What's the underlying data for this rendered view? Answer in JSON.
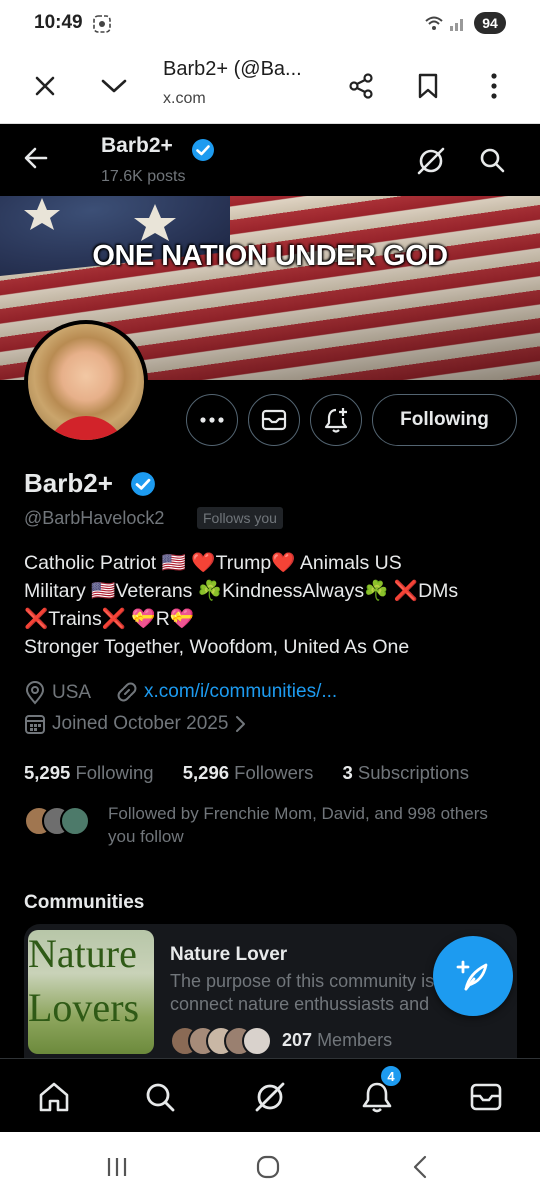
{
  "status_bar": {
    "time": "10:49",
    "battery": "94"
  },
  "browser_tab": {
    "title": "Barb2+ (@Ba...",
    "url": "x.com"
  },
  "profile_header": {
    "name": "Barb2+",
    "posts": "17.6K posts"
  },
  "banner": {
    "text": "ONE NATION UNDER GOD"
  },
  "actions": {
    "following_label": "Following"
  },
  "profile": {
    "name": "Barb2+",
    "handle": "@BarbHavelock2",
    "follows_you": "Follows you",
    "bio": [
      "Catholic Patriot 🇺🇸 ❤️Trump❤️ Animals US",
      "Military 🇺🇸Veterans ☘️KindnessAlways☘️ ❌DMs",
      "❌Trains❌  💝R💝",
      "Stronger Together, Woofdom, United As One"
    ],
    "location": "USA",
    "link": "x.com/i/communities/...",
    "joined": "Joined October 2025"
  },
  "stats": {
    "following_count": "5,295",
    "following_label": "Following",
    "followers_count": "5,296",
    "followers_label": "Followers",
    "subscriptions_count": "3",
    "subscriptions_label": "Subscriptions"
  },
  "followed_by": {
    "text": "Followed by Frenchie Mom, David, and 998 others you follow"
  },
  "communities": {
    "title": "Communities",
    "card": {
      "thumb_word1": "Nature",
      "thumb_word2": "Lovers",
      "name": "Nature Lover",
      "desc_line1": "The purpose of this community is to",
      "desc_line2": "connect nature enthussiasts and",
      "members_count": "207",
      "members_label": "Members"
    }
  },
  "bottom_nav": {
    "notifications_badge": "4"
  },
  "colors": {
    "accent": "#1d9bf0",
    "background": "#000000",
    "muted": "#71767b"
  }
}
